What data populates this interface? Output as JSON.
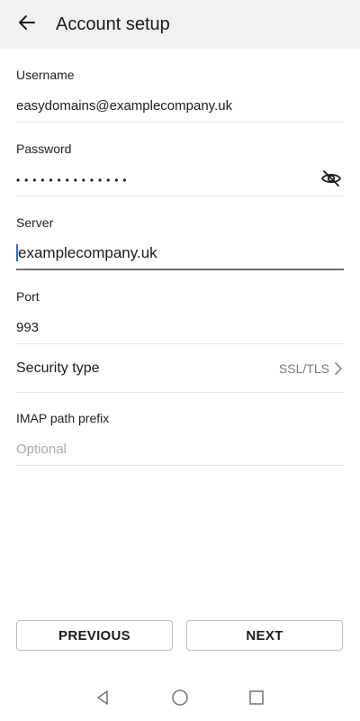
{
  "header": {
    "back_icon": "arrow-left-icon",
    "title": "Account setup"
  },
  "form": {
    "username": {
      "label": "Username",
      "value": "easydomains@examplecompany.uk"
    },
    "password": {
      "label": "Password",
      "value": "••••••••••••••",
      "toggle_icon": "eye-slash-icon"
    },
    "server": {
      "label": "Server",
      "value": "examplecompany.uk"
    },
    "port": {
      "label": "Port",
      "value": "993"
    },
    "security_type": {
      "label": "Security type",
      "value": "SSL/TLS",
      "chevron_icon": "chevron-right-icon"
    },
    "imap_path_prefix": {
      "label": "IMAP path prefix",
      "placeholder": "Optional"
    }
  },
  "actions": {
    "previous_label": "PREVIOUS",
    "next_label": "NEXT"
  },
  "system_nav": {
    "back_icon": "triangle-back-icon",
    "home_icon": "circle-home-icon",
    "recents_icon": "square-recents-icon"
  },
  "colors": {
    "header_bg": "#f1f1f1",
    "cursor": "#2b6fd6",
    "placeholder": "#a8a8a8",
    "secondary_text": "#7b7b7b"
  }
}
